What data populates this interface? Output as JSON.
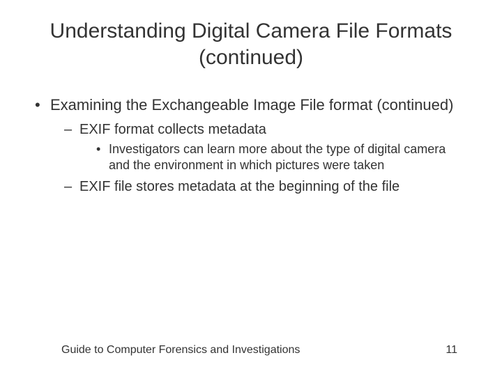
{
  "title": "Understanding Digital Camera File Formats (continued)",
  "bullets": {
    "b1": "Examining the Exchangeable Image File format (continued)",
    "b1_1": "EXIF format collects metadata",
    "b1_1_1": "Investigators can learn more about the type of digital camera and the environment in which pictures were taken",
    "b1_2": "EXIF file stores metadata at the beginning of the file"
  },
  "footer": {
    "text": "Guide to Computer Forensics and Investigations",
    "page": "11"
  }
}
